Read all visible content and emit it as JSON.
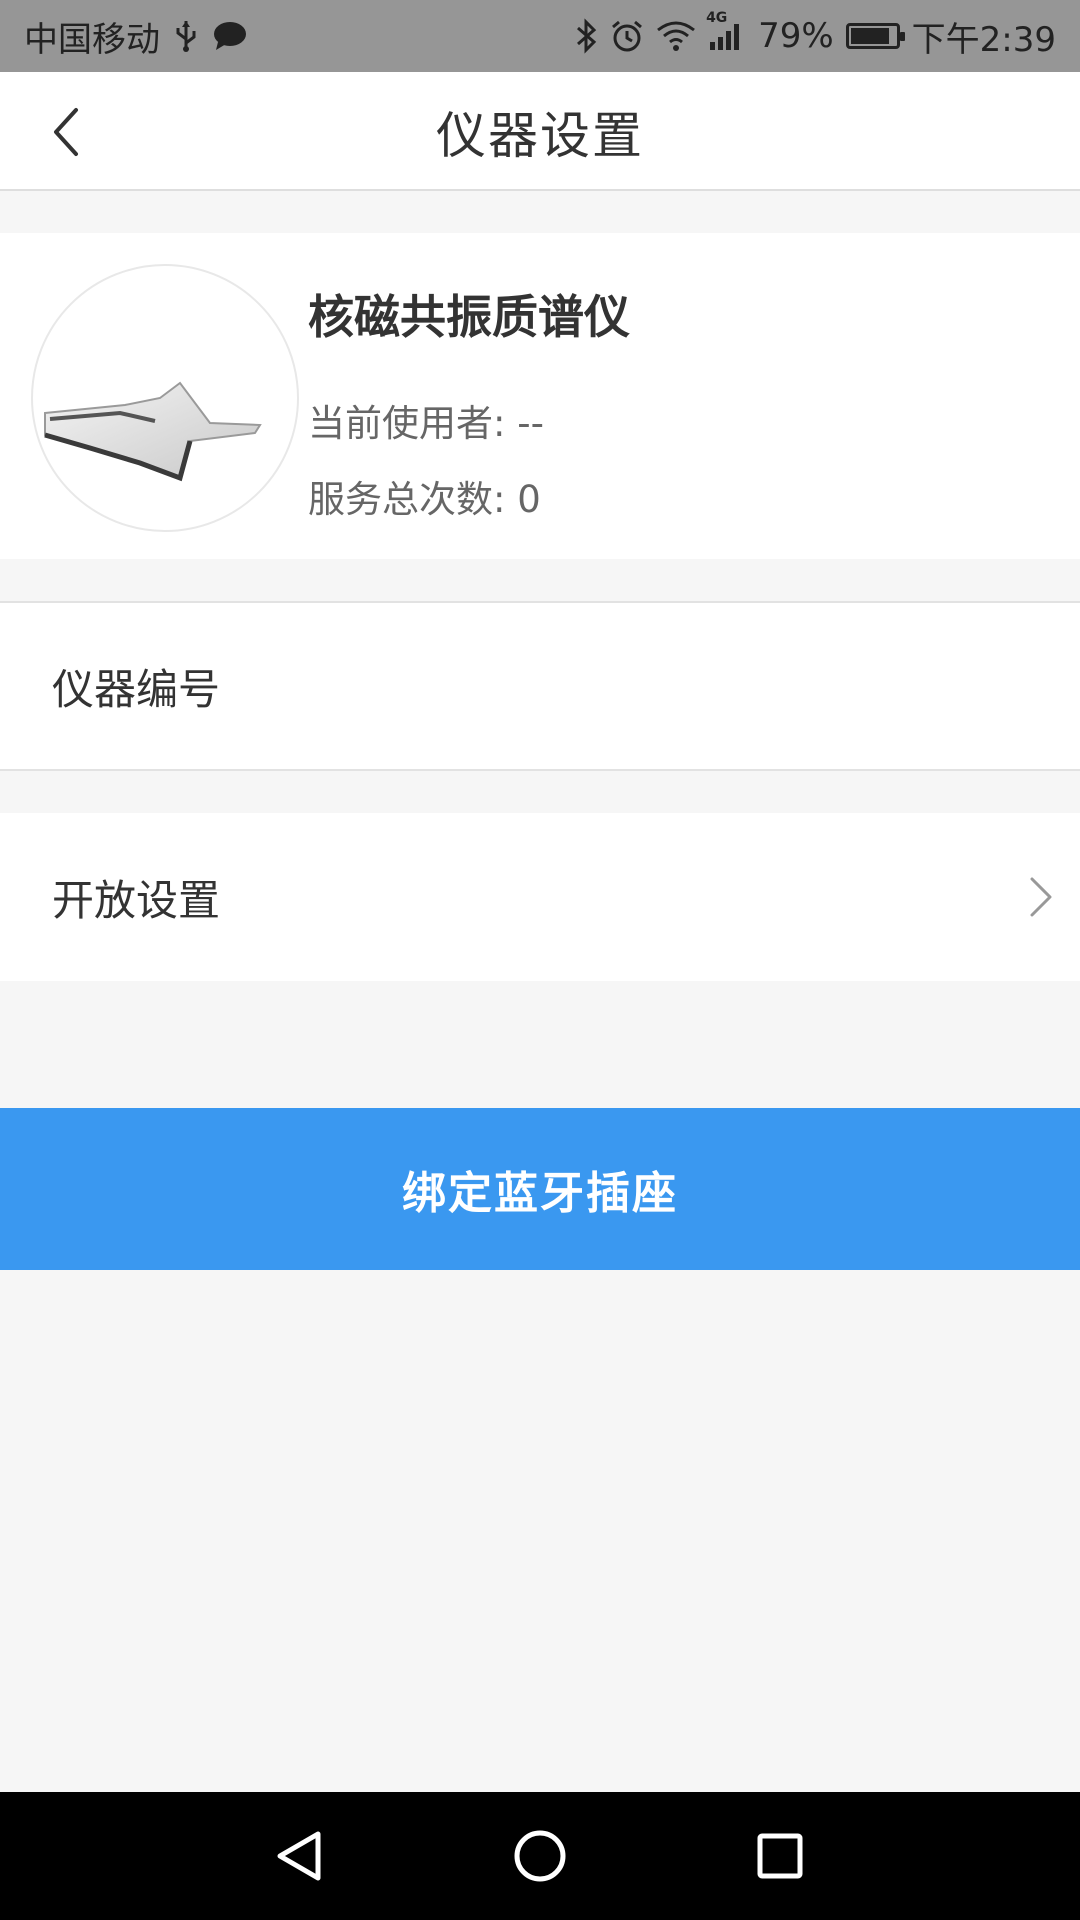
{
  "status_bar": {
    "carrier": "中国移动",
    "network_label": "4G",
    "battery_text": "79%",
    "battery_level": 0.79,
    "time": "下午2:39",
    "icons": [
      "usb-icon",
      "message-icon",
      "bluetooth-icon",
      "alarm-icon",
      "wifi-icon",
      "signal-icon",
      "battery-icon"
    ]
  },
  "header": {
    "title": "仪器设置",
    "back_icon": "chevron-left-icon"
  },
  "device": {
    "name": "核磁共振质谱仪",
    "current_user_line": "当前使用者: --",
    "service_count_line": "服务总次数: 0"
  },
  "rows": {
    "instrument_number_label": "仪器编号",
    "open_settings_label": "开放设置"
  },
  "actions": {
    "bind_label": "绑定蓝牙插座"
  },
  "colors": {
    "primary": "#3a98f0",
    "status_bar_bg": "#969696",
    "page_bg": "#f6f6f6",
    "text_primary": "#333333",
    "text_secondary": "#666666"
  },
  "system_nav": {
    "icons": [
      "back-triangle-icon",
      "home-circle-icon",
      "recents-square-icon"
    ]
  }
}
